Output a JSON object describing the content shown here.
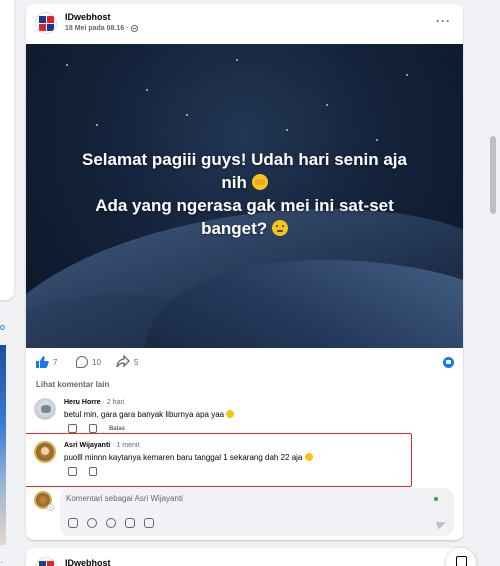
{
  "post": {
    "page_name": "IDwebhost",
    "date": "18 Mei pada 08.16 ·",
    "more_label": "···",
    "image_text": {
      "line1": "Selamat pagiii guys! Udah hari senin aja",
      "line2": "nih",
      "line3": "Ada yang ngerasa gak mei ini sat-set",
      "line4": "banget?"
    },
    "like_count": "7",
    "comment_count": "10",
    "share_count": "5",
    "more_comments_label": "Lihat komentar lain"
  },
  "comments": [
    {
      "author": "Heru Horre",
      "time": "· 2 hari",
      "text": "betul min, gara gara banyak liburnya apa yaa",
      "reply_label": "Balas"
    },
    {
      "author": "Asri Wijayanti",
      "time": "· 1 menit",
      "text": "puolll minnn kaytanya kemaren baru tanggal 1 sekarang dah 22 aja"
    }
  ],
  "composer": {
    "placeholder": "Komentari sebagai Asri Wijayanti",
    "tools": [
      "sticker-icon",
      "gif-icon",
      "emoji-icon",
      "camera-icon",
      "avatar-sticker-icon"
    ]
  },
  "next_post": {
    "page_name": "IDwebhost"
  },
  "sidebar": {
    "link_text": "o",
    "dot_text": "·"
  },
  "colors": {
    "facebook_blue": "#1877f2",
    "highlight_red": "#e22d2d",
    "brand_red": "#e11d2e",
    "brand_navy": "#1e3a8a"
  }
}
